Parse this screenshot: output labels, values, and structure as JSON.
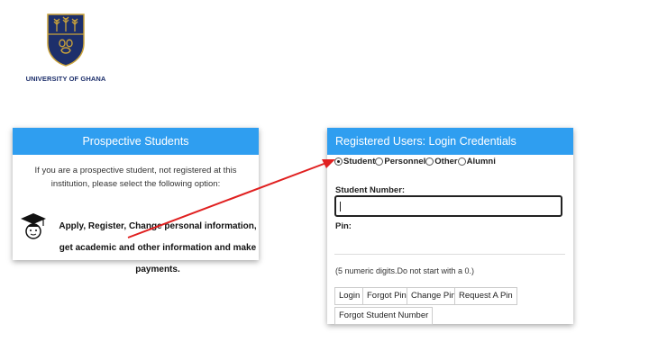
{
  "logo": {
    "caption": "UNIVERSITY OF GHANA",
    "colors": {
      "shield": "#1d2f6b",
      "gold": "#c9a23a"
    }
  },
  "prospective": {
    "title": "Prospective Students",
    "description": "If you are a prospective student, not registered at this institution, please select the following option:",
    "link_text": "Apply, Register, Change personal information, get academic and other information and make payments.",
    "icon": "graduation-cap-icon"
  },
  "registered": {
    "title": "Registered Users: Login Credentials",
    "user_types": [
      {
        "label": "Student",
        "checked": true
      },
      {
        "label": "Personnel",
        "checked": false
      },
      {
        "label": "Other",
        "checked": false
      },
      {
        "label": "Alumni",
        "checked": false
      }
    ],
    "student_number_label": "Student Number:",
    "student_number_value": "",
    "pin_label": "Pin:",
    "hint": "(5 numeric digits.Do not start with a 0.)",
    "buttons": {
      "login": "Login",
      "forgot_pin": "Forgot Pin",
      "change_pin": "Change Pin",
      "request_pin": "Request A Pin",
      "forgot_student_number": "Forgot Student Number"
    }
  },
  "colors": {
    "header": "#2f9ef0",
    "arrow": "#e02020"
  }
}
